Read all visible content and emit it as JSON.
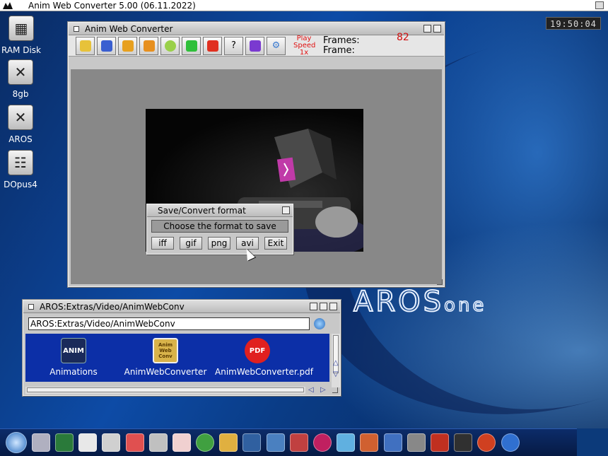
{
  "menubar": {
    "title": "Anim Web Converter 5.00 (06.11.2022)"
  },
  "clock": "19:50:04",
  "desktop_icons": [
    {
      "label": "RAM Disk",
      "icon": "chip-icon"
    },
    {
      "label": "8gb",
      "icon": "drive-icon"
    },
    {
      "label": "AROS",
      "icon": "drive-icon"
    },
    {
      "label": "DOpus4",
      "icon": "dopus-icon"
    }
  ],
  "main_window": {
    "title": "Anim Web Converter",
    "play_label": "Play",
    "speed_label": "Speed",
    "speed_value": "1x",
    "frames_label": "Frames:",
    "frame_label": "Frame:",
    "frames_value": "82"
  },
  "dialog": {
    "title": "Save/Convert format",
    "prompt": "Choose the format to save",
    "buttons": [
      "iff",
      "gif",
      "png",
      "avi",
      "Exit"
    ]
  },
  "drawer": {
    "title": "AROS:Extras/Video/AnimWebConv",
    "path": "AROS:Extras/Video/AnimWebConv",
    "files": [
      {
        "label": "Animations",
        "badge": "ANIM"
      },
      {
        "label": "AnimWebConverter",
        "badge": "Anim Web Conv"
      },
      {
        "label": "AnimWebConverter.pdf",
        "badge": "PDF"
      }
    ]
  },
  "colors": {
    "accent": "#0c2fa7",
    "frames_red": "#d01010",
    "desktop": "#0d4ba6"
  }
}
